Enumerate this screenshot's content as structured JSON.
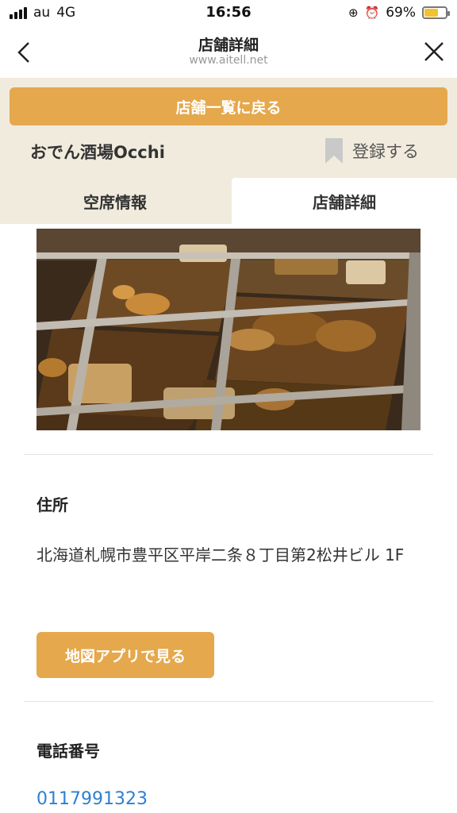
{
  "status_bar": {
    "carrier": "au",
    "network": "4G",
    "time": "16:56",
    "battery_percent": "69%",
    "battery_level": 0.69
  },
  "nav": {
    "title": "店舗詳細",
    "url": "www.aitell.net",
    "back_icon": "chevron-left-icon",
    "close_icon": "close-icon"
  },
  "shop": {
    "back_to_list_label": "店舗一覧に戻る",
    "name": "おでん酒場Occhi",
    "register_label": "登録する"
  },
  "tabs": [
    {
      "label": "空席情報",
      "active": false
    },
    {
      "label": "店舗詳細",
      "active": true
    }
  ],
  "address": {
    "label": "住所",
    "value": "北海道札幌市豊平区平岸二条８丁目第2松井ビル 1F",
    "map_button_label": "地図アプリで見る"
  },
  "phone": {
    "label": "電話番号",
    "value": "0117991323"
  },
  "colors": {
    "accent": "#e5a84c",
    "header_bg": "#f1ebde",
    "link": "#2f7fd0"
  }
}
